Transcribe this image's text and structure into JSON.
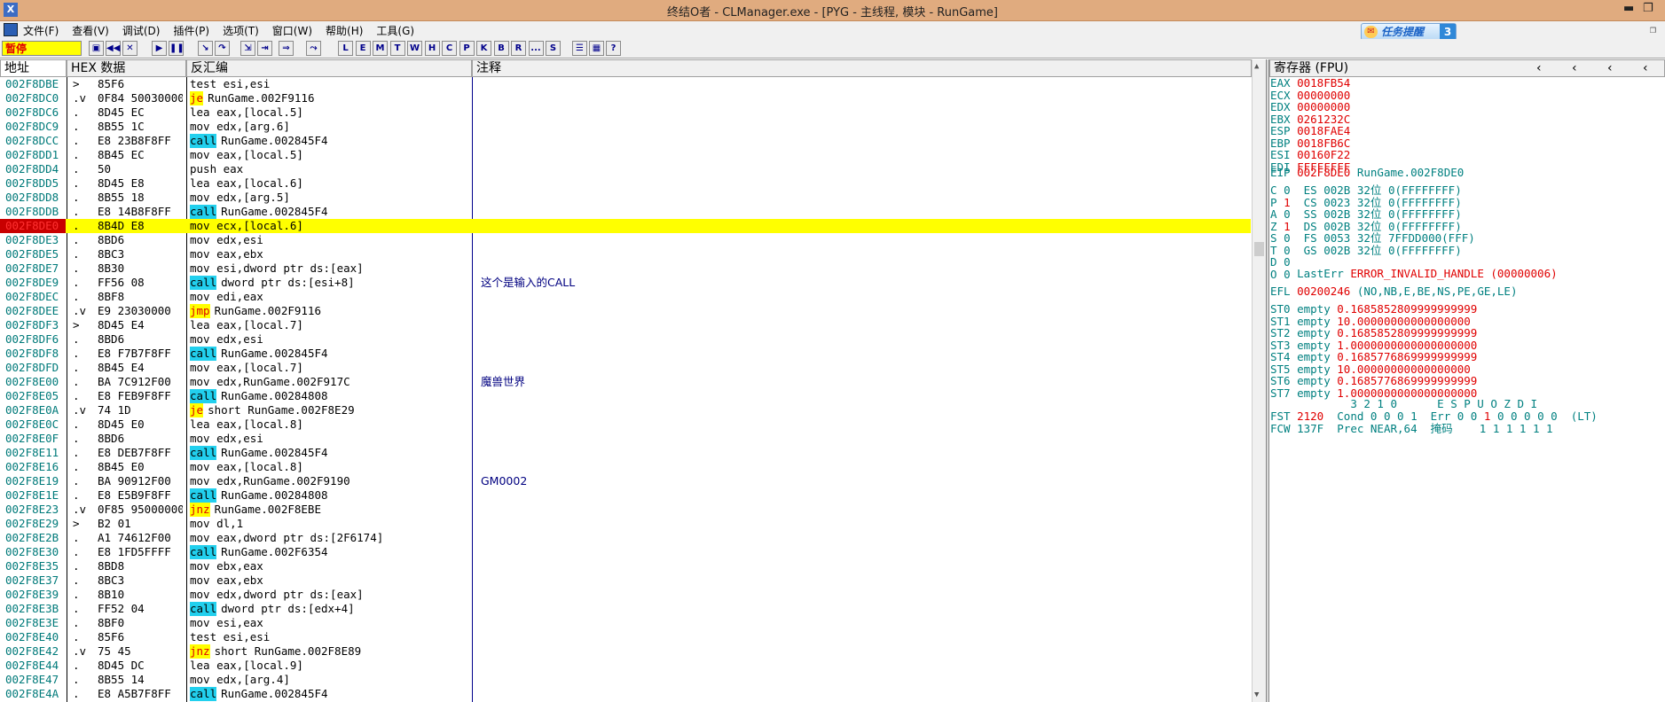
{
  "window": {
    "title": "终结O者 - CLManager.exe - [PYG - 主线程, 模块 - RunGame]",
    "icon_label": "X"
  },
  "menu": [
    "文件(F)",
    "查看(V)",
    "调试(D)",
    "插件(P)",
    "选项(T)",
    "窗口(W)",
    "帮助(H)",
    "工具(G)"
  ],
  "task_button": {
    "label": "任务提醒",
    "count": "3"
  },
  "toolbar": {
    "status": "暂停",
    "letters": [
      "L",
      "E",
      "M",
      "T",
      "W",
      "H",
      "C",
      "P",
      "K",
      "B",
      "R",
      "...",
      "S"
    ]
  },
  "columns": {
    "address": "地址",
    "hex": "HEX 数据",
    "disasm": "反汇编",
    "comment": "注释",
    "registers": "寄存器 (FPU)"
  },
  "rows": [
    {
      "addr": "002F8DBE",
      "mark": ">",
      "hex": "85F6",
      "mn": "",
      "op": "test esi,esi",
      "cmt": ""
    },
    {
      "addr": "002F8DC0",
      "mark": ".v",
      "hex": "0F84 50030000",
      "mn": "je",
      "op": "RunGame.002F9116",
      "cmt": ""
    },
    {
      "addr": "002F8DC6",
      "mark": ".",
      "hex": "8D45 EC",
      "mn": "",
      "op": "lea eax,[local.5]",
      "cmt": ""
    },
    {
      "addr": "002F8DC9",
      "mark": ".",
      "hex": "8B55 1C",
      "mn": "",
      "op": "mov edx,[arg.6]",
      "cmt": ""
    },
    {
      "addr": "002F8DCC",
      "mark": ".",
      "hex": "E8 23B8F8FF",
      "mn": "call",
      "op": "RunGame.002845F4",
      "cmt": ""
    },
    {
      "addr": "002F8DD1",
      "mark": ".",
      "hex": "8B45 EC",
      "mn": "",
      "op": "mov eax,[local.5]",
      "cmt": ""
    },
    {
      "addr": "002F8DD4",
      "mark": ".",
      "hex": "50",
      "mn": "",
      "op": "push eax",
      "cmt": ""
    },
    {
      "addr": "002F8DD5",
      "mark": ".",
      "hex": "8D45 E8",
      "mn": "",
      "op": "lea eax,[local.6]",
      "cmt": ""
    },
    {
      "addr": "002F8DD8",
      "mark": ".",
      "hex": "8B55 18",
      "mn": "",
      "op": "mov edx,[arg.5]",
      "cmt": ""
    },
    {
      "addr": "002F8DDB",
      "mark": ".",
      "hex": "E8 14B8F8FF",
      "mn": "call",
      "op": "RunGame.002845F4",
      "cmt": ""
    },
    {
      "addr": "002F8DE0",
      "mark": ".",
      "hex": "8B4D E8",
      "mn": "",
      "op": "mov ecx,[local.6]",
      "cmt": "",
      "cur": true
    },
    {
      "addr": "002F8DE3",
      "mark": ".",
      "hex": "8BD6",
      "mn": "",
      "op": "mov edx,esi",
      "cmt": ""
    },
    {
      "addr": "002F8DE5",
      "mark": ".",
      "hex": "8BC3",
      "mn": "",
      "op": "mov eax,ebx",
      "cmt": ""
    },
    {
      "addr": "002F8DE7",
      "mark": ".",
      "hex": "8B30",
      "mn": "",
      "op": "mov esi,dword ptr ds:[eax]",
      "cmt": ""
    },
    {
      "addr": "002F8DE9",
      "mark": ".",
      "hex": "FF56 08",
      "mn": "call",
      "op": "dword ptr ds:[esi+8]",
      "cmt": "这个是输入的CALL"
    },
    {
      "addr": "002F8DEC",
      "mark": ".",
      "hex": "8BF8",
      "mn": "",
      "op": "mov edi,eax",
      "cmt": ""
    },
    {
      "addr": "002F8DEE",
      "mark": ".v",
      "hex": "E9 23030000",
      "mn": "jmp",
      "op": "RunGame.002F9116",
      "cmt": ""
    },
    {
      "addr": "002F8DF3",
      "mark": ">",
      "hex": "8D45 E4",
      "mn": "",
      "op": "lea eax,[local.7]",
      "cmt": ""
    },
    {
      "addr": "002F8DF6",
      "mark": ".",
      "hex": "8BD6",
      "mn": "",
      "op": "mov edx,esi",
      "cmt": ""
    },
    {
      "addr": "002F8DF8",
      "mark": ".",
      "hex": "E8 F7B7F8FF",
      "mn": "call",
      "op": "RunGame.002845F4",
      "cmt": ""
    },
    {
      "addr": "002F8DFD",
      "mark": ".",
      "hex": "8B45 E4",
      "mn": "",
      "op": "mov eax,[local.7]",
      "cmt": ""
    },
    {
      "addr": "002F8E00",
      "mark": ".",
      "hex": "BA 7C912F00",
      "mn": "",
      "op": "mov edx,RunGame.002F917C",
      "cmt": "魔兽世界"
    },
    {
      "addr": "002F8E05",
      "mark": ".",
      "hex": "E8 FEB9F8FF",
      "mn": "call",
      "op": "RunGame.00284808",
      "cmt": ""
    },
    {
      "addr": "002F8E0A",
      "mark": ".v",
      "hex": "74 1D",
      "mn": "je",
      "op": "short RunGame.002F8E29",
      "cmt": ""
    },
    {
      "addr": "002F8E0C",
      "mark": ".",
      "hex": "8D45 E0",
      "mn": "",
      "op": "lea eax,[local.8]",
      "cmt": ""
    },
    {
      "addr": "002F8E0F",
      "mark": ".",
      "hex": "8BD6",
      "mn": "",
      "op": "mov edx,esi",
      "cmt": ""
    },
    {
      "addr": "002F8E11",
      "mark": ".",
      "hex": "E8 DEB7F8FF",
      "mn": "call",
      "op": "RunGame.002845F4",
      "cmt": ""
    },
    {
      "addr": "002F8E16",
      "mark": ".",
      "hex": "8B45 E0",
      "mn": "",
      "op": "mov eax,[local.8]",
      "cmt": ""
    },
    {
      "addr": "002F8E19",
      "mark": ".",
      "hex": "BA 90912F00",
      "mn": "",
      "op": "mov edx,RunGame.002F9190",
      "cmt": "GM0002"
    },
    {
      "addr": "002F8E1E",
      "mark": ".",
      "hex": "E8 E5B9F8FF",
      "mn": "call",
      "op": "RunGame.00284808",
      "cmt": ""
    },
    {
      "addr": "002F8E23",
      "mark": ".v",
      "hex": "0F85 95000000",
      "mn": "jnz",
      "op": "RunGame.002F8EBE",
      "cmt": ""
    },
    {
      "addr": "002F8E29",
      "mark": ">",
      "hex": "B2 01",
      "mn": "",
      "op": "mov dl,1",
      "cmt": ""
    },
    {
      "addr": "002F8E2B",
      "mark": ".",
      "hex": "A1 74612F00",
      "mn": "",
      "op": "mov eax,dword ptr ds:[2F6174]",
      "cmt": ""
    },
    {
      "addr": "002F8E30",
      "mark": ".",
      "hex": "E8 1FD5FFFF",
      "mn": "call",
      "op": "RunGame.002F6354",
      "cmt": ""
    },
    {
      "addr": "002F8E35",
      "mark": ".",
      "hex": "8BD8",
      "mn": "",
      "op": "mov ebx,eax",
      "cmt": ""
    },
    {
      "addr": "002F8E37",
      "mark": ".",
      "hex": "8BC3",
      "mn": "",
      "op": "mov eax,ebx",
      "cmt": ""
    },
    {
      "addr": "002F8E39",
      "mark": ".",
      "hex": "8B10",
      "mn": "",
      "op": "mov edx,dword ptr ds:[eax]",
      "cmt": ""
    },
    {
      "addr": "002F8E3B",
      "mark": ".",
      "hex": "FF52 04",
      "mn": "call",
      "op": "dword ptr ds:[edx+4]",
      "cmt": ""
    },
    {
      "addr": "002F8E3E",
      "mark": ".",
      "hex": "8BF0",
      "mn": "",
      "op": "mov esi,eax",
      "cmt": ""
    },
    {
      "addr": "002F8E40",
      "mark": ".",
      "hex": "85F6",
      "mn": "",
      "op": "test esi,esi",
      "cmt": ""
    },
    {
      "addr": "002F8E42",
      "mark": ".v",
      "hex": "75 45",
      "mn": "jnz",
      "op": "short RunGame.002F8E89",
      "cmt": ""
    },
    {
      "addr": "002F8E44",
      "mark": ".",
      "hex": "8D45 DC",
      "mn": "",
      "op": "lea eax,[local.9]",
      "cmt": ""
    },
    {
      "addr": "002F8E47",
      "mark": ".",
      "hex": "8B55 14",
      "mn": "",
      "op": "mov edx,[arg.4]",
      "cmt": ""
    },
    {
      "addr": "002F8E4A",
      "mark": ".",
      "hex": "E8 A5B7F8FF",
      "mn": "call",
      "op": "RunGame.002845F4",
      "cmt": ""
    }
  ],
  "registers": {
    "gp": [
      {
        "name": "EAX",
        "val": "0018FB54",
        "info": ""
      },
      {
        "name": "ECX",
        "val": "00000000",
        "info": ""
      },
      {
        "name": "EDX",
        "val": "00000000",
        "info": ""
      },
      {
        "name": "EBX",
        "val": "0261232C",
        "info": ""
      },
      {
        "name": "ESP",
        "val": "0018FAE4",
        "info": ""
      },
      {
        "name": "EBP",
        "val": "0018FB6C",
        "info": ""
      },
      {
        "name": "ESI",
        "val": "00160F22",
        "info": ""
      },
      {
        "name": "EDI",
        "val": "FFFFFFFF",
        "info": ""
      }
    ],
    "eip": {
      "name": "EIP",
      "val": "002F8DE0",
      "info": "RunGame.002F8DE0"
    },
    "flags": [
      {
        "f": "C",
        "v": "0",
        "seg": "ES 002B 32位 0(FFFFFFFF)"
      },
      {
        "f": "P",
        "v": "1",
        "seg": "CS 0023 32位 0(FFFFFFFF)"
      },
      {
        "f": "A",
        "v": "0",
        "seg": "SS 002B 32位 0(FFFFFFFF)"
      },
      {
        "f": "Z",
        "v": "1",
        "seg": "DS 002B 32位 0(FFFFFFFF)"
      },
      {
        "f": "S",
        "v": "0",
        "seg": "FS 0053 32位 7FFDD000(FFF)"
      },
      {
        "f": "T",
        "v": "0",
        "seg": "GS 002B 32位 0(FFFFFFFF)"
      },
      {
        "f": "D",
        "v": "0",
        "seg": ""
      },
      {
        "f": "O",
        "v": "0",
        "seg": ""
      }
    ],
    "lasterr": {
      "label": "LastErr",
      "val": "ERROR_INVALID_HANDLE (00000006)"
    },
    "efl": {
      "name": "EFL",
      "val": "00200246",
      "info": "(NO,NB,E,BE,NS,PE,GE,LE)"
    },
    "fpu": [
      {
        "name": "ST0",
        "tag": "empty",
        "val": "0.1685852809999999999"
      },
      {
        "name": "ST1",
        "tag": "empty",
        "val": "10.00000000000000000"
      },
      {
        "name": "ST2",
        "tag": "empty",
        "val": "0.1685852809999999999"
      },
      {
        "name": "ST3",
        "tag": "empty",
        "val": "1.0000000000000000000"
      },
      {
        "name": "ST4",
        "tag": "empty",
        "val": "0.1685776869999999999"
      },
      {
        "name": "ST5",
        "tag": "empty",
        "val": "10.00000000000000000"
      },
      {
        "name": "ST6",
        "tag": "empty",
        "val": "0.1685776869999999999"
      },
      {
        "name": "ST7",
        "tag": "empty",
        "val": "1.0000000000000000000"
      }
    ],
    "fpu_header": "3 2 1 0      E S P U O Z D I",
    "fst": {
      "name": "FST",
      "val": "2120",
      "cond_label": "Cond 0 0 0 1",
      "err_label": "Err 0 0",
      "err_hi": "1",
      "err_rest": "0 0 0 0 0  (LT)"
    },
    "fcw": {
      "name": "FCW",
      "val": "137F",
      "prec": "Prec NEAR,64",
      "mask_label": "掩码",
      "mask": "1 1 1 1 1 1"
    }
  }
}
